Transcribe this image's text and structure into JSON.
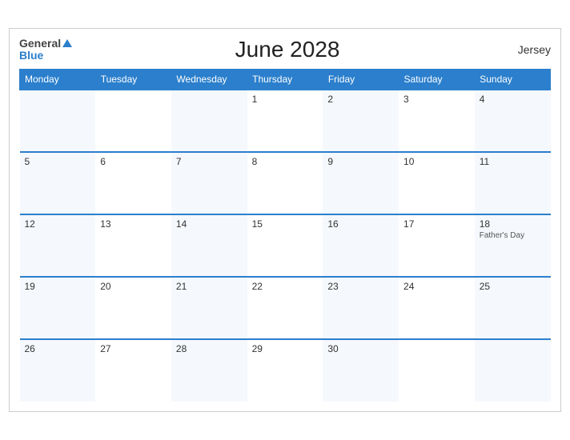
{
  "header": {
    "title": "June 2028",
    "locale": "Jersey",
    "logo_general": "General",
    "logo_blue": "Blue"
  },
  "weekdays": [
    "Monday",
    "Tuesday",
    "Wednesday",
    "Thursday",
    "Friday",
    "Saturday",
    "Sunday"
  ],
  "weeks": [
    [
      {
        "day": "",
        "event": ""
      },
      {
        "day": "",
        "event": ""
      },
      {
        "day": "",
        "event": ""
      },
      {
        "day": "1",
        "event": ""
      },
      {
        "day": "2",
        "event": ""
      },
      {
        "day": "3",
        "event": ""
      },
      {
        "day": "4",
        "event": ""
      }
    ],
    [
      {
        "day": "5",
        "event": ""
      },
      {
        "day": "6",
        "event": ""
      },
      {
        "day": "7",
        "event": ""
      },
      {
        "day": "8",
        "event": ""
      },
      {
        "day": "9",
        "event": ""
      },
      {
        "day": "10",
        "event": ""
      },
      {
        "day": "11",
        "event": ""
      }
    ],
    [
      {
        "day": "12",
        "event": ""
      },
      {
        "day": "13",
        "event": ""
      },
      {
        "day": "14",
        "event": ""
      },
      {
        "day": "15",
        "event": ""
      },
      {
        "day": "16",
        "event": ""
      },
      {
        "day": "17",
        "event": ""
      },
      {
        "day": "18",
        "event": "Father's Day"
      }
    ],
    [
      {
        "day": "19",
        "event": ""
      },
      {
        "day": "20",
        "event": ""
      },
      {
        "day": "21",
        "event": ""
      },
      {
        "day": "22",
        "event": ""
      },
      {
        "day": "23",
        "event": ""
      },
      {
        "day": "24",
        "event": ""
      },
      {
        "day": "25",
        "event": ""
      }
    ],
    [
      {
        "day": "26",
        "event": ""
      },
      {
        "day": "27",
        "event": ""
      },
      {
        "day": "28",
        "event": ""
      },
      {
        "day": "29",
        "event": ""
      },
      {
        "day": "30",
        "event": ""
      },
      {
        "day": "",
        "event": ""
      },
      {
        "day": "",
        "event": ""
      }
    ]
  ]
}
